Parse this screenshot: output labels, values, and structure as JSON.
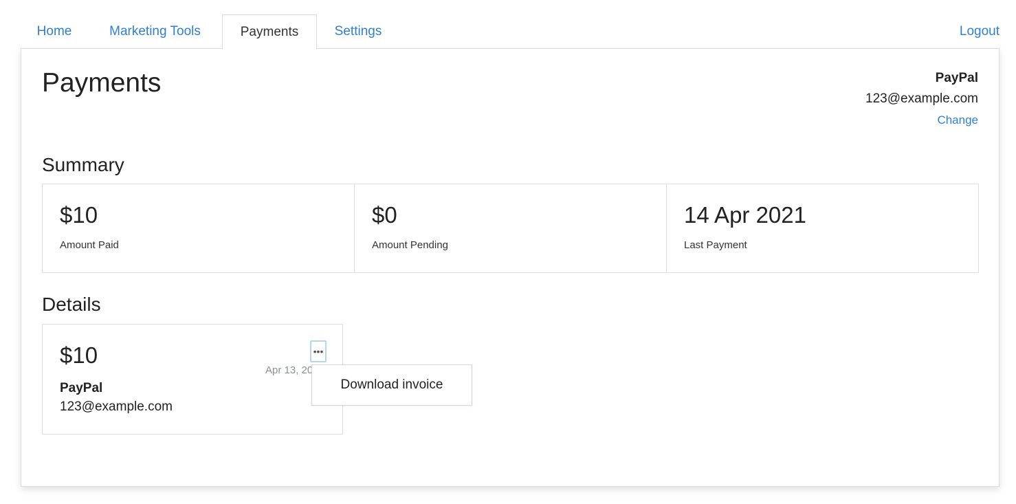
{
  "nav": {
    "tabs": [
      {
        "label": "Home"
      },
      {
        "label": "Marketing Tools"
      },
      {
        "label": "Payments"
      },
      {
        "label": "Settings"
      }
    ],
    "logout_label": "Logout"
  },
  "page": {
    "title": "Payments"
  },
  "account": {
    "provider": "PayPal",
    "email": "123@example.com",
    "change_label": "Change"
  },
  "summary": {
    "heading": "Summary",
    "cells": [
      {
        "value": "$10",
        "label": "Amount Paid"
      },
      {
        "value": "$0",
        "label": "Amount Pending"
      },
      {
        "value": "14 Apr 2021",
        "label": "Last Payment"
      }
    ]
  },
  "details": {
    "heading": "Details",
    "card": {
      "amount": "$10",
      "date": "Apr 13, 2021",
      "provider": "PayPal",
      "email": "123@example.com",
      "more_glyph": "•••"
    },
    "menu": {
      "download_label": "Download invoice"
    }
  },
  "colors": {
    "link": "#2f7fd6",
    "text": "#222222",
    "border": "#dcdcdc",
    "muted": "#8a8f96",
    "focus": "#b8d4f4"
  }
}
